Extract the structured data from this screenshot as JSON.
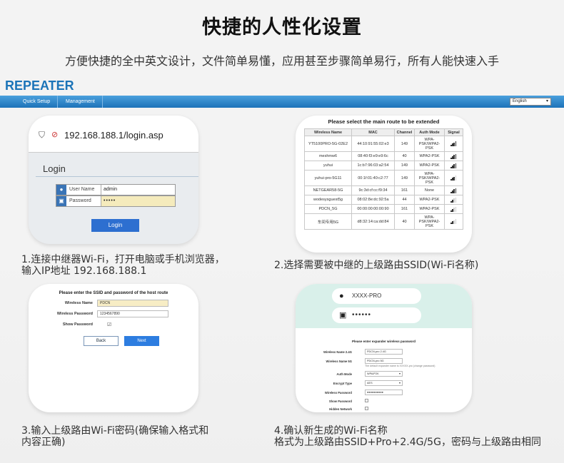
{
  "header": {
    "title": "快捷的人性化设置",
    "subtitle": "方便快捷的全中英文设计，文件简单易懂，应用甚至步骤简单易行，所有人能快速入手"
  },
  "repeater_ui": {
    "brand": "REPEATER",
    "tabs": [
      "Quick Setup",
      "Management"
    ],
    "language": "English",
    "accent": "#1d72b8"
  },
  "step1": {
    "url": "192.168.188.1/login.asp",
    "login_title": "Login",
    "username_label": "User Name",
    "username_value": "admin",
    "password_label": "Password",
    "password_value": "•••••",
    "login_button": "Login",
    "caption_line1": "1.连接中继器Wi-Fi，打开电脑或手机浏览器，",
    "caption_line2": "输入IP地址 192.168.188.1"
  },
  "step2": {
    "table_title": "Please select the main route to be extended",
    "columns": [
      "Wireless Name",
      "MAC",
      "Channel",
      "Auth Mode",
      "Signal"
    ],
    "rows": [
      {
        "name": "YT5100PRO-5G-02E2",
        "mac": "44:10:91:55:02:e3",
        "channel": "149",
        "auth": "WPA-PSK/WPA2-PSK",
        "signal": 4
      },
      {
        "name": "meshmw6",
        "mac": "08:40:f3:e9:e9:6c",
        "channel": "40",
        "auth": "WPA2-PSK",
        "signal": 4
      },
      {
        "name": "yuhui",
        "mac": "1c:b7:96:03:a2:54",
        "channel": "149",
        "auth": "WPA2-PSK",
        "signal": 4
      },
      {
        "name": "yuhui-pro-5G11",
        "mac": "00:1f:01:40:c2:77",
        "channel": "149",
        "auth": "WPA-PSK/WPA2-PSK",
        "signal": 3
      },
      {
        "name": "NETGEAR58-5G",
        "mac": "9c:3d:cf:cc:f9:34",
        "channel": "161",
        "auth": "None",
        "signal": 4
      },
      {
        "name": "wodesysguest5g",
        "mac": "08:02:8e:dc:92:5a",
        "channel": "44",
        "auth": "WPA2-PSK",
        "signal": 2
      },
      {
        "name": "PDCN_5G",
        "mac": "00:00:00:00:00:90",
        "channel": "161",
        "auth": "WPA2-PSK",
        "signal": 2
      },
      {
        "name": "车间专用5G",
        "mac": "d8:32:14:ca:dd:84",
        "channel": "40",
        "auth": "WPA-PSK/WPA2-PSK",
        "signal": 2
      }
    ],
    "caption": "2.选择需要被中继的上级路由SSID(Wi-Fi名称)"
  },
  "step3": {
    "form_title": "Please enter the SSID and password of the host route",
    "wireless_name_label": "Wireless Name",
    "wireless_name_value": "PDCN",
    "wireless_password_label": "Wireless Password",
    "wireless_password_value": "1234567890",
    "show_password_label": "Show Password",
    "checkbox_mark": "☑",
    "back_button": "Back",
    "next_button": "Next",
    "caption_line1": "3.输入上级路由Wi-Fi密码(确保输入格式和",
    "caption_line2": "内容正确)"
  },
  "step4": {
    "ssid_pill": "XXXX-PRO",
    "password_pill": "••••••",
    "form_title": "Please enter expander wireless password",
    "fields": [
      {
        "label": "Wireless Name 2.4G",
        "value": "PDCN-pro 2.4G"
      },
      {
        "label": "Wireless Name 5G",
        "value": "PDCN-pro 5G"
      }
    ],
    "note": "The default expander name is XXXXX-pro (change password)",
    "auth_mode_label": "Auth Mode",
    "auth_mode_value": "WPA/P2K",
    "encrypt_label": "Encrypt Type",
    "encrypt_value": "AES",
    "wireless_password_label": "Wireless Password",
    "wireless_password_value": "●●●●●●●●●●",
    "show_password_label": "Show Password",
    "hidden_network_label": "Hidden Network",
    "caption_line1": "4.确认新生成的Wi-Fi名称",
    "caption_line2": "格式为上级路由SSID+Pro+2.4G/5G，密码与上级路由相同"
  }
}
